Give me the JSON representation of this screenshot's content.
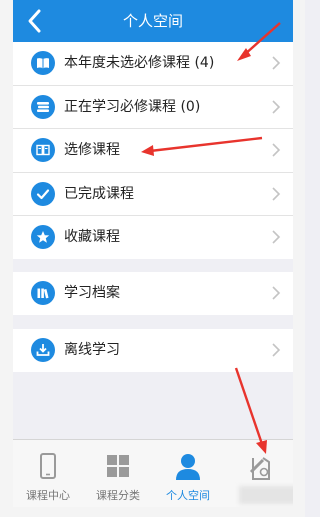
{
  "header": {
    "title": "个人空间"
  },
  "menu": {
    "group1": [
      {
        "label": "本年度未选必修课程 (4)",
        "icon": "book-icon"
      },
      {
        "label": "正在学习必修课程 (0)",
        "icon": "books-stack-icon"
      },
      {
        "label": "选修课程",
        "icon": "open-book-icon"
      },
      {
        "label": "已完成课程",
        "icon": "checkmark-icon"
      },
      {
        "label": "收藏课程",
        "icon": "star-icon"
      }
    ],
    "group2": [
      {
        "label": "学习档案",
        "icon": "archive-icon"
      }
    ],
    "group3": [
      {
        "label": "离线学习",
        "icon": "download-icon"
      }
    ]
  },
  "tabbar": {
    "tabs": [
      {
        "label": "课程中心",
        "icon": "phone-icon"
      },
      {
        "label": "课程分类",
        "icon": "grid-icon"
      },
      {
        "label": "个人空间",
        "icon": "person-icon",
        "active": true
      },
      {
        "label": "",
        "icon": "edit-icon"
      }
    ]
  },
  "colors": {
    "accent": "#1e8ae0",
    "annotation": "#e8342d"
  }
}
